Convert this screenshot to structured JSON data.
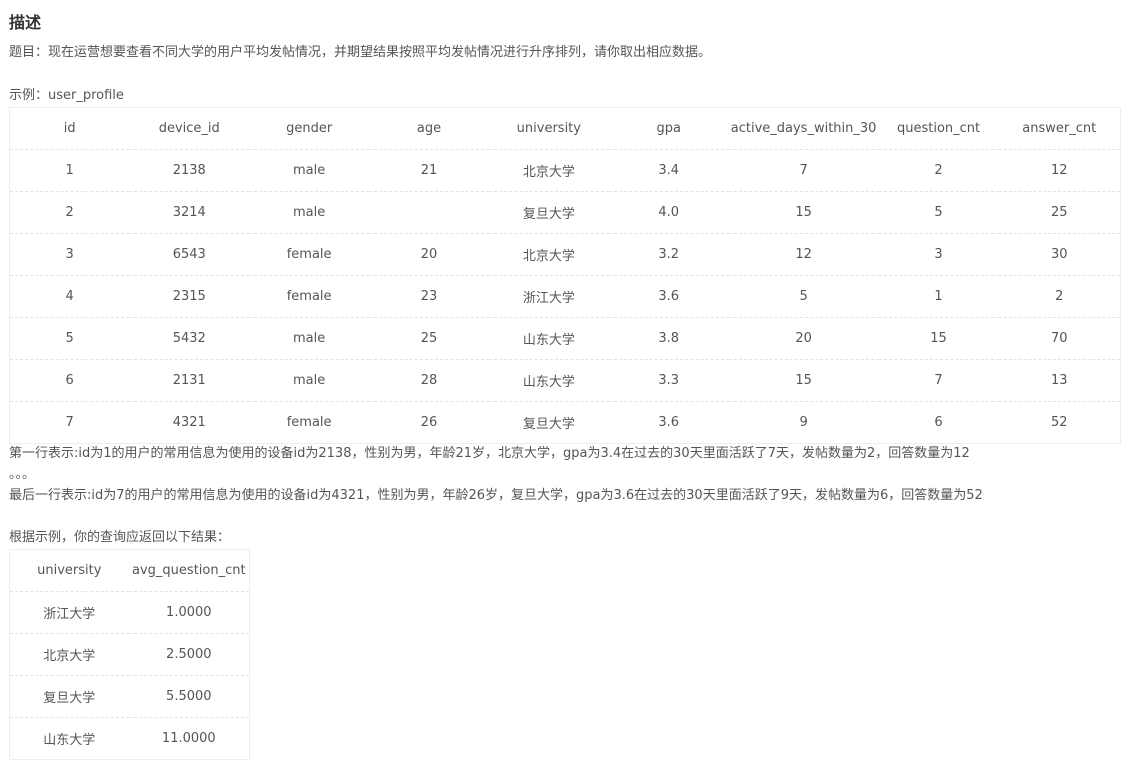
{
  "heading": "描述",
  "question": "题目：现在运营想要查看不同大学的用户平均发帖情况，并期望结果按照平均发帖情况进行升序排列，请你取出相应数据。",
  "example_label": "示例：user_profile",
  "user_profile": {
    "columns": [
      "id",
      "device_id",
      "gender",
      "age",
      "university",
      "gpa",
      "active_days_within_30",
      "question_cnt",
      "answer_cnt"
    ],
    "rows": [
      [
        "1",
        "2138",
        "male",
        "21",
        "北京大学",
        "3.4",
        "7",
        "2",
        "12"
      ],
      [
        "2",
        "3214",
        "male",
        "",
        "复旦大学",
        "4.0",
        "15",
        "5",
        "25"
      ],
      [
        "3",
        "6543",
        "female",
        "20",
        "北京大学",
        "3.2",
        "12",
        "3",
        "30"
      ],
      [
        "4",
        "2315",
        "female",
        "23",
        "浙江大学",
        "3.6",
        "5",
        "1",
        "2"
      ],
      [
        "5",
        "5432",
        "male",
        "25",
        "山东大学",
        "3.8",
        "20",
        "15",
        "70"
      ],
      [
        "6",
        "2131",
        "male",
        "28",
        "山东大学",
        "3.3",
        "15",
        "7",
        "13"
      ],
      [
        "7",
        "4321",
        "female",
        "26",
        "复旦大学",
        "3.6",
        "9",
        "6",
        "52"
      ]
    ]
  },
  "note_first_row": "第一行表示:id为1的用户的常用信息为使用的设备id为2138，性别为男，年龄21岁，北京大学，gpa为3.4在过去的30天里面活跃了7天，发帖数量为2，回答数量为12",
  "note_ellipsis": "。。。",
  "note_last_row": "最后一行表示:id为7的用户的常用信息为使用的设备id为4321，性别为男，年龄26岁，复旦大学，gpa为3.6在过去的30天里面活跃了9天，发帖数量为6，回答数量为52",
  "result_label": "根据示例，你的查询应返回以下结果：",
  "result": {
    "columns": [
      "university",
      "avg_question_cnt"
    ],
    "rows": [
      [
        "浙江大学",
        "1.0000"
      ],
      [
        "北京大学",
        "2.5000"
      ],
      [
        "复旦大学",
        "5.5000"
      ],
      [
        "山东大学",
        "11.0000"
      ]
    ]
  }
}
